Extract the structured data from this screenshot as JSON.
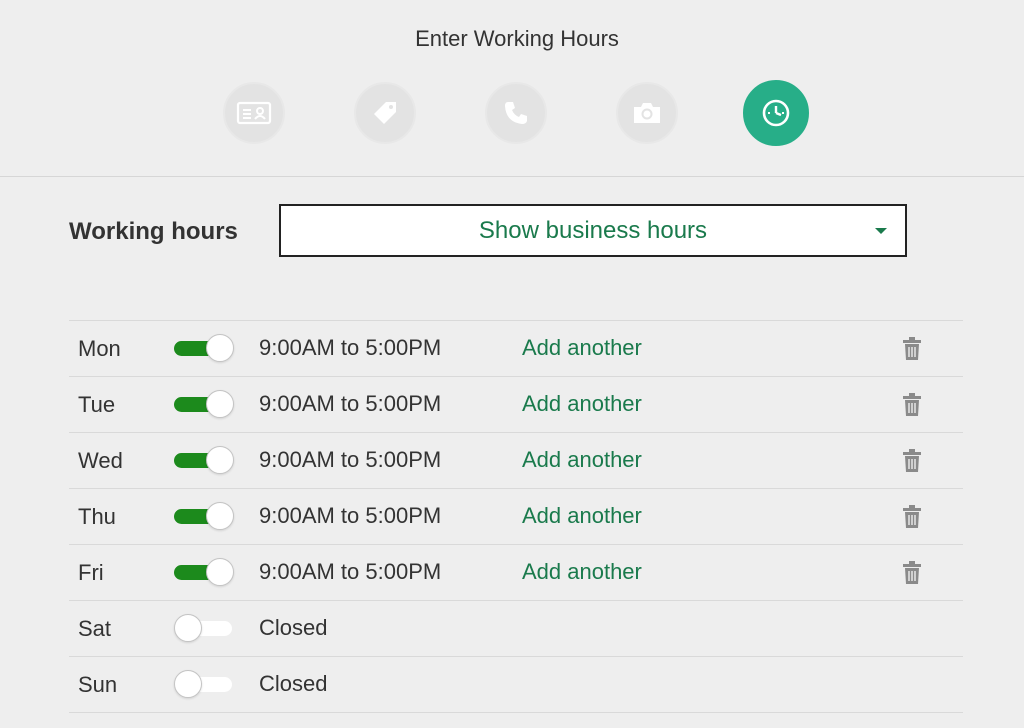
{
  "header": {
    "title": "Enter Working Hours",
    "steps": [
      {
        "icon": "id-card-icon",
        "active": false
      },
      {
        "icon": "tag-icon",
        "active": false
      },
      {
        "icon": "phone-icon",
        "active": false
      },
      {
        "icon": "camera-icon",
        "active": false
      },
      {
        "icon": "clock-icon",
        "active": true
      }
    ]
  },
  "working_hours": {
    "label": "Working hours",
    "select_value": "Show business hours"
  },
  "days": [
    {
      "day": "Mon",
      "enabled": true,
      "hours": "9:00AM to 5:00PM",
      "add_label": "Add another"
    },
    {
      "day": "Tue",
      "enabled": true,
      "hours": "9:00AM to 5:00PM",
      "add_label": "Add another"
    },
    {
      "day": "Wed",
      "enabled": true,
      "hours": "9:00AM to 5:00PM",
      "add_label": "Add another"
    },
    {
      "day": "Thu",
      "enabled": true,
      "hours": "9:00AM to 5:00PM",
      "add_label": "Add another"
    },
    {
      "day": "Fri",
      "enabled": true,
      "hours": "9:00AM to 5:00PM",
      "add_label": "Add another"
    },
    {
      "day": "Sat",
      "enabled": false,
      "hours": "Closed"
    },
    {
      "day": "Sun",
      "enabled": false,
      "hours": "Closed"
    }
  ],
  "colors": {
    "accent": "#27ae88",
    "link": "#1a7a4c",
    "toggle_on": "#1c8a1c",
    "background": "#eeeeee"
  }
}
